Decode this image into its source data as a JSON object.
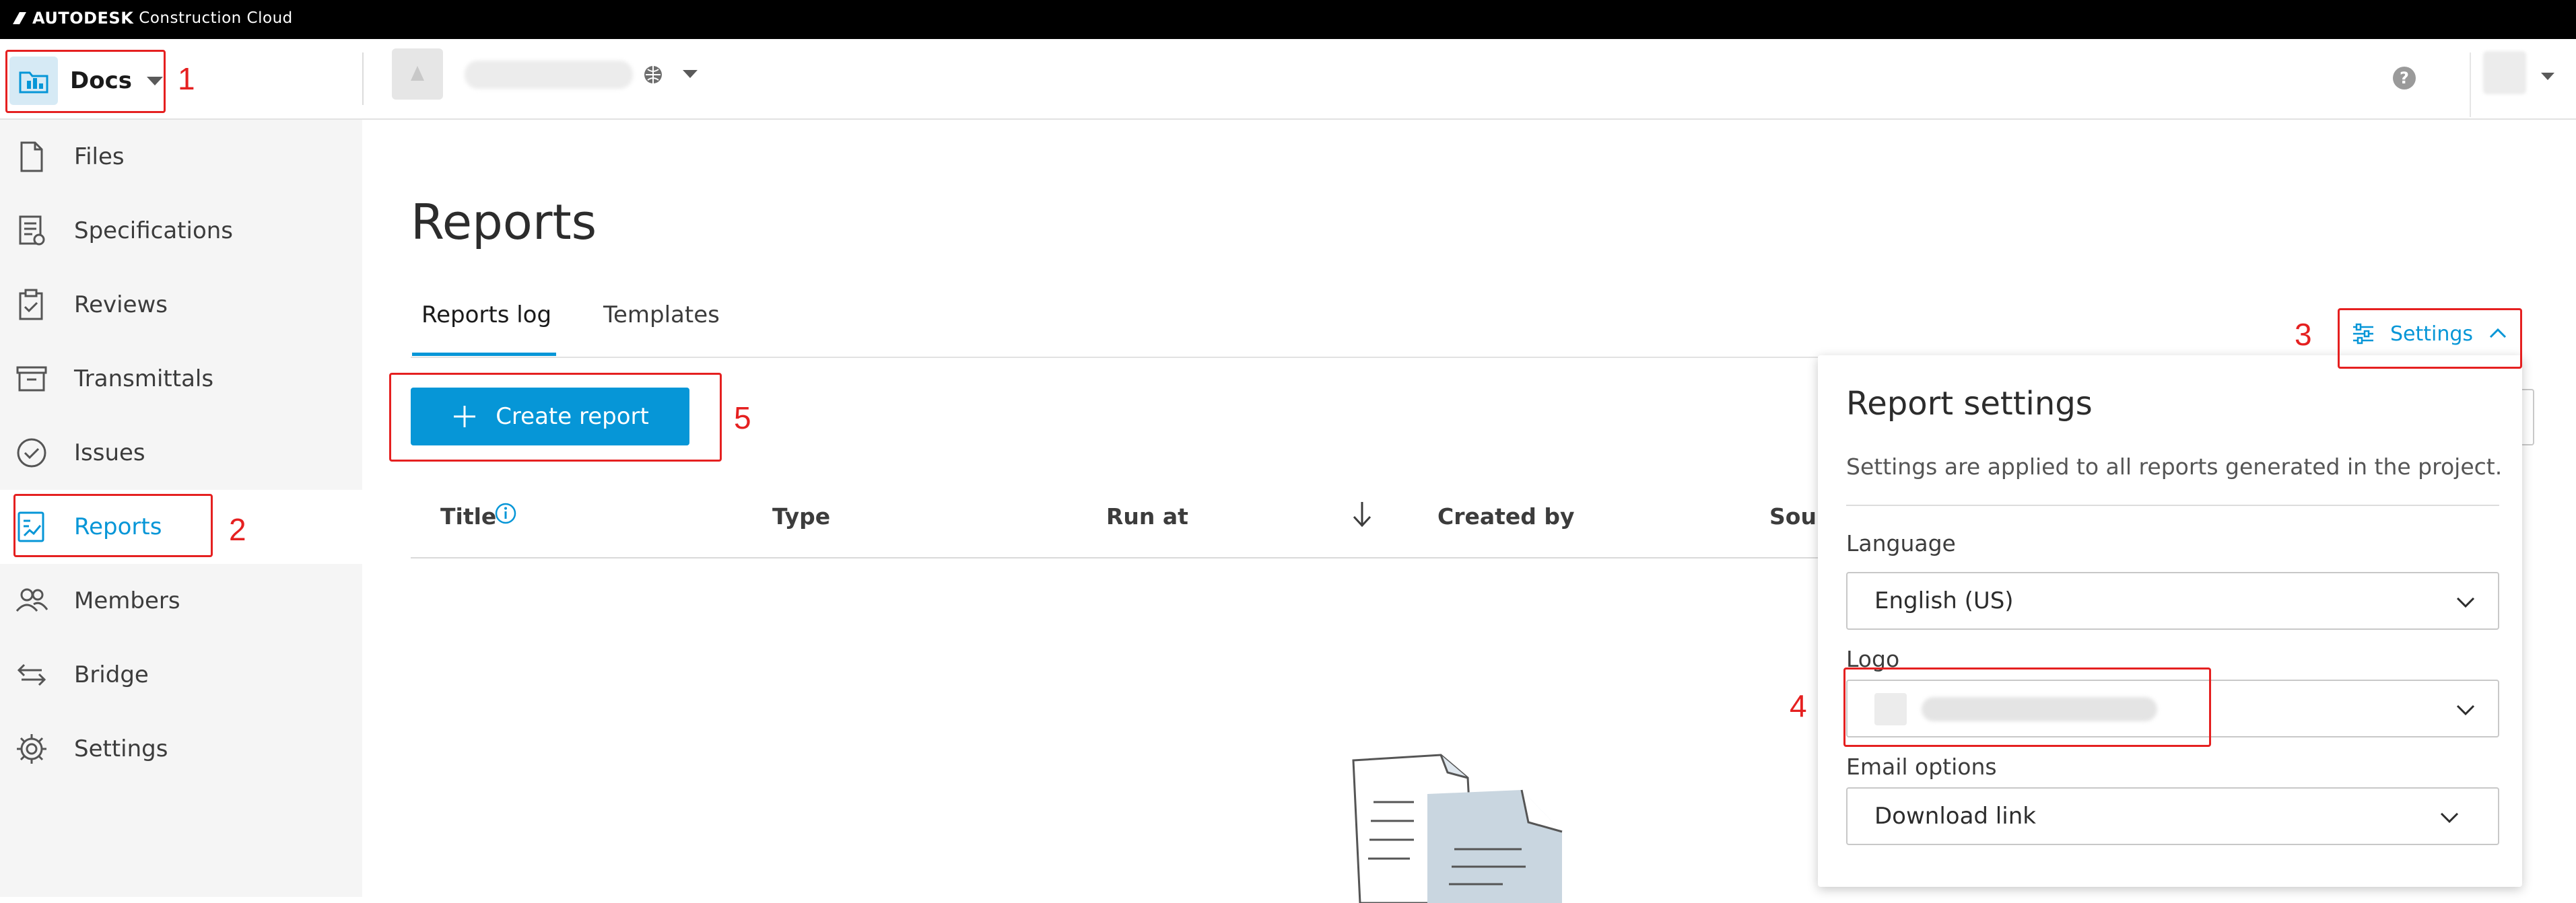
{
  "topbar": {
    "brand_name": "AUTODESK",
    "brand_product": "Construction Cloud"
  },
  "header": {
    "app_switcher_label": "Docs",
    "project_name": ""
  },
  "sidebar": {
    "items": [
      {
        "label": "Files",
        "icon": "file-icon"
      },
      {
        "label": "Specifications",
        "icon": "specifications-icon"
      },
      {
        "label": "Reviews",
        "icon": "clipboard-icon"
      },
      {
        "label": "Transmittals",
        "icon": "transmittal-icon"
      },
      {
        "label": "Issues",
        "icon": "check-circle-icon"
      },
      {
        "label": "Reports",
        "icon": "report-icon",
        "active": true
      },
      {
        "label": "Members",
        "icon": "members-icon"
      },
      {
        "label": "Bridge",
        "icon": "bridge-icon"
      },
      {
        "label": "Settings",
        "icon": "gear-icon"
      }
    ]
  },
  "main": {
    "title": "Reports",
    "tabs": [
      {
        "label": "Reports log",
        "active": true
      },
      {
        "label": "Templates",
        "active": false
      }
    ],
    "create_button_label": "Create report",
    "table_headers": {
      "title": "Title",
      "type": "Type",
      "run_at": "Run at",
      "created_by": "Created by",
      "source": "Sour"
    }
  },
  "settings_toggle": {
    "label": "Settings"
  },
  "settings_panel": {
    "title": "Report settings",
    "description": "Settings are applied to all reports generated in the project.",
    "language_label": "Language",
    "language_value": "English (US)",
    "logo_label": "Logo",
    "logo_value": "",
    "email_label": "Email options",
    "email_value": "Download link"
  },
  "annotations": [
    "1",
    "2",
    "3",
    "4",
    "5"
  ],
  "colors": {
    "accent": "#0696d7",
    "annotation": "#e52020",
    "sidebar_bg": "#f5f5f5",
    "topbar_bg": "#000000"
  }
}
